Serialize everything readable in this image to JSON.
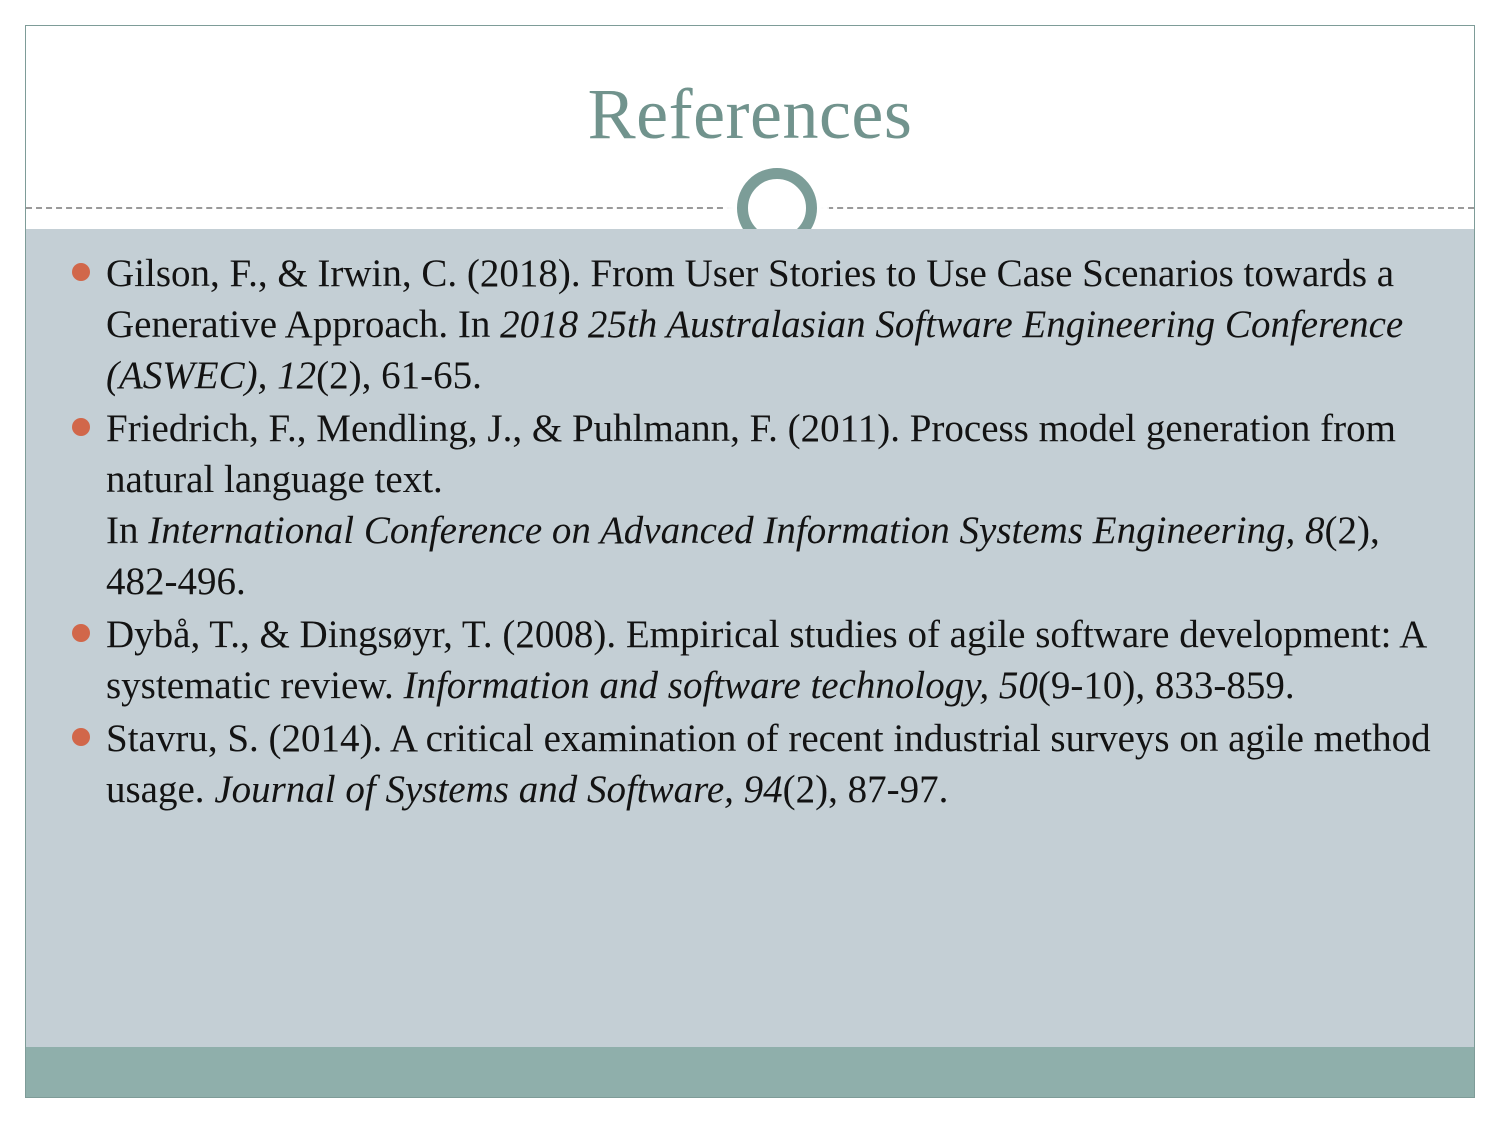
{
  "slide": {
    "title": "References",
    "colors": {
      "title_text": "#71938d",
      "body_background": "#c4cfd5",
      "footer_band": "#8fafab",
      "bullet": "#d1674a",
      "slide_border": "#7e9c98",
      "divider": "#9a9a9a",
      "body_text": "#131313"
    }
  },
  "references": [
    {
      "id": "reference-gilson-irwin-2018",
      "plain": "Gilson, F., & Irwin, C. (2018). From User Stories to Use Case Scenarios towards a Generative Approach. In 2018 25th Australasian Software Engineering Conference (ASWEC), 12(2), 61-65.",
      "parts": [
        {
          "text": "Gilson, F., & Irwin, C. (2018). From User Stories to Use Case Scenarios towards a Generative Approach. In ",
          "style": "normal"
        },
        {
          "text": "2018 25th Australasian Software Engineering Conference (ASWEC), 12",
          "style": "italic"
        },
        {
          "text": "(2), 61-65.",
          "style": "normal"
        }
      ]
    },
    {
      "id": "reference-friedrich-mendling-puhlmann-2011",
      "plain": "Friedrich, F., Mendling, J., & Puhlmann, F. (2011). Process model generation from natural language text. In International Conference on Advanced Information Systems Engineering, 8(2), 482-496.",
      "parts": [
        {
          "text": "Friedrich, F., Mendling, J., & Puhlmann, F. (2011). Process model generation from natural language text.",
          "style": "normal"
        },
        {
          "text": "",
          "style": "break"
        },
        {
          "text": "In ",
          "style": "normal"
        },
        {
          "text": "International Conference on Advanced Information Systems Engineering, 8",
          "style": "italic"
        },
        {
          "text": "(2), 482-496.",
          "style": "normal"
        }
      ]
    },
    {
      "id": "reference-dyba-dingsoyr-2008",
      "plain": "Dybå, T., & Dingsøyr, T. (2008). Empirical studies of agile software development: A systematic review. Information and software technology, 50(9-10), 833-859.",
      "parts": [
        {
          "text": "Dybå, T., & Dingsøyr, T. (2008). Empirical studies of agile software development: A systematic review. ",
          "style": "normal"
        },
        {
          "text": "Information and software technology, 50",
          "style": "italic"
        },
        {
          "text": "(9-10), 833-859.",
          "style": "normal"
        }
      ]
    },
    {
      "id": "reference-stavru-2014",
      "plain": "Stavru, S. (2014). A critical examination of recent industrial surveys on agile method usage. Journal of Systems and Software, 94(2), 87-97.",
      "parts": [
        {
          "text": "Stavru, S. (2014). A critical examination of recent industrial surveys on agile method usage. ",
          "style": "normal"
        },
        {
          "text": "Journal of Systems and Software, 94",
          "style": "italic"
        },
        {
          "text": "(2), 87-97.",
          "style": "normal"
        }
      ]
    }
  ]
}
